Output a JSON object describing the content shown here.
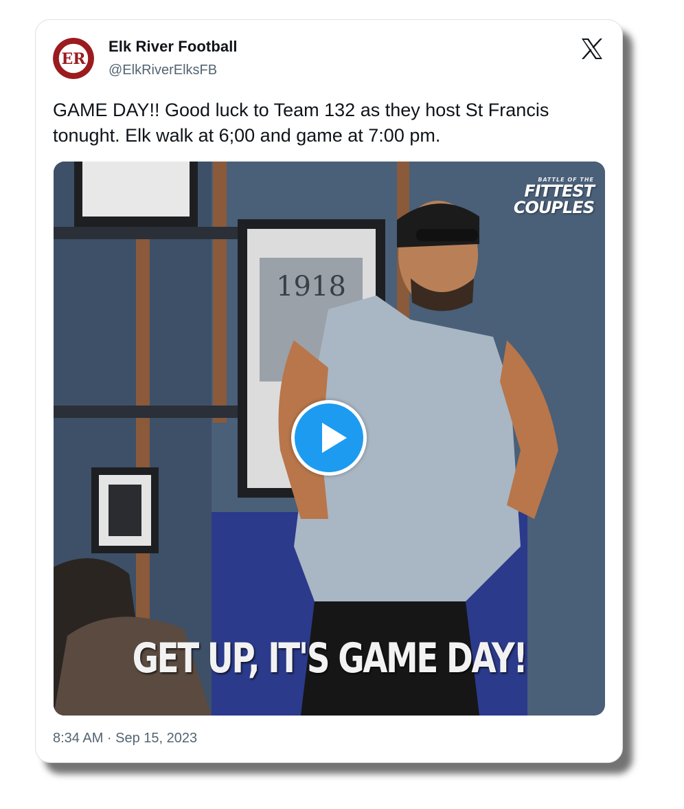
{
  "tweet": {
    "author_name": "Elk River Football",
    "author_handle": "@ElkRiverElksFB",
    "avatar_icon": "elk-river-football-logo",
    "text": "GAME DAY!! Good luck to Team 132 as they host St Francis tonught. Elk walk at 6;00 and game at 7:00 pm.",
    "timestamp": "8:34 AM · Sep 15, 2023"
  },
  "media": {
    "type": "video-gif",
    "caption": "GET UP, IT'S GAME DAY!",
    "brand_small": "BATTLE OF THE",
    "brand_line1": "FITTEST",
    "brand_line2": "COUPLES",
    "play_icon": "play-icon"
  },
  "colors": {
    "accent": "#1d9bf0",
    "logo_red": "#9b1b1f",
    "text_primary": "#0f1419",
    "text_secondary": "#536471"
  }
}
